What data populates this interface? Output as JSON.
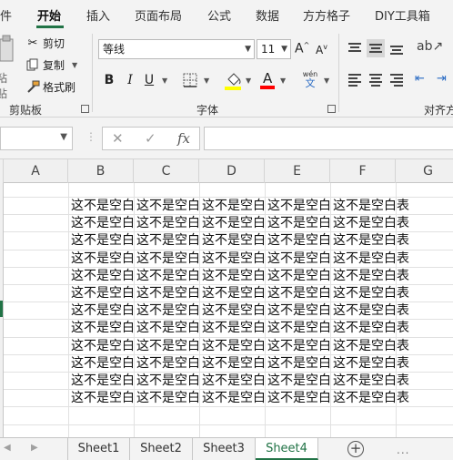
{
  "menu": {
    "items": [
      {
        "label": "件"
      },
      {
        "label": "开始"
      },
      {
        "label": "插入"
      },
      {
        "label": "页面布局"
      },
      {
        "label": "公式"
      },
      {
        "label": "数据"
      },
      {
        "label": "方方格子"
      },
      {
        "label": "DIY工具箱"
      }
    ]
  },
  "ribbon": {
    "clipboard": {
      "cut_label": "剪切",
      "copy_label": "复制",
      "format_painter_label": "格式刷",
      "paste_partial_label": "粘贴",
      "group_label": "剪贴板"
    },
    "font": {
      "font_name": "等线",
      "font_size": "11",
      "bold": "B",
      "italic": "I",
      "underline": "U",
      "wen_top": "wén",
      "wen_bottom": "文",
      "group_label": "字体",
      "fill_color": "#ffff00",
      "font_color": "#ff0000"
    },
    "alignment": {
      "group_label_partial": "对齐方"
    }
  },
  "formula_bar": {
    "cancel_symbol": "✕",
    "enter_symbol": "✓",
    "fx_symbol": "fx"
  },
  "grid": {
    "columns": [
      "A",
      "B",
      "C",
      "D",
      "E",
      "F",
      "G"
    ],
    "cell_text": "这不是空白表",
    "filled_rows": 12,
    "filled_columns": [
      "B",
      "C",
      "D",
      "E",
      "F"
    ]
  },
  "sheets": {
    "tabs": [
      "Sheet1",
      "Sheet2",
      "Sheet3",
      "Sheet4"
    ],
    "active": "Sheet4",
    "add_symbol": "+",
    "more_symbol": "..."
  },
  "colors": {
    "accent": "#217346",
    "ribbon_bg": "#f3f3f3"
  }
}
